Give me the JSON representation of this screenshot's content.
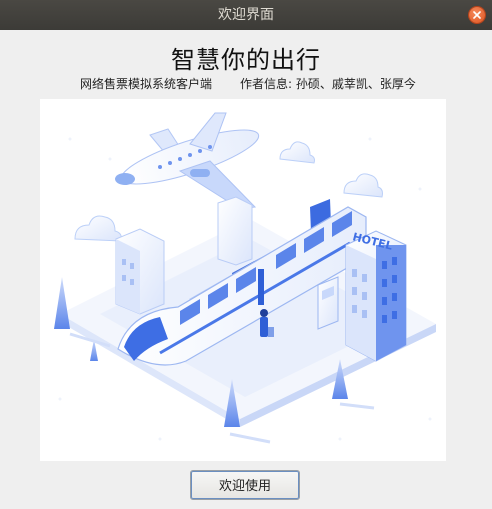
{
  "window": {
    "title": "欢迎界面"
  },
  "main": {
    "headline": "智慧你的出行",
    "client_name": "网络售票模拟系统客户端",
    "authors": "作者信息: 孙硕、戚莘凯、张厚今",
    "illustration_sign": "HOTEL",
    "welcome_button": "欢迎使用"
  },
  "colors": {
    "titlebar": "#3c3b37",
    "close_button": "#e95420",
    "illustration_blue": "#4a78e8"
  }
}
